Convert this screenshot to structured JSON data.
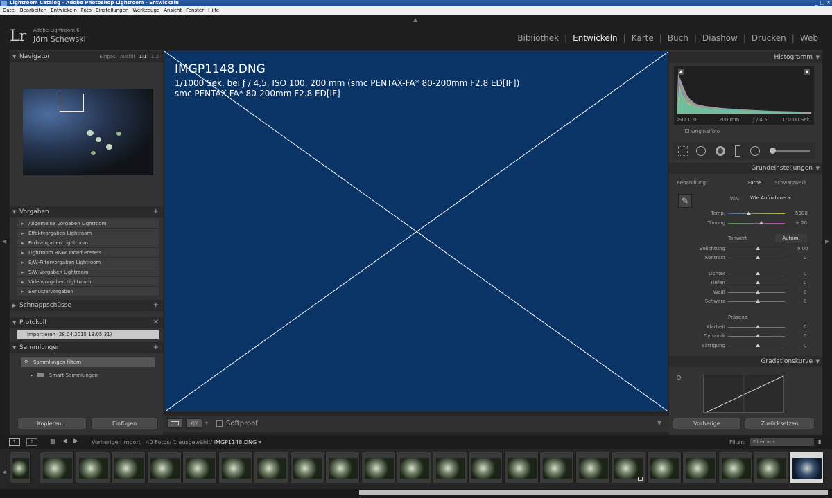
{
  "window": {
    "title": "Lightroom Catalog - Adobe Photoshop Lightroom - Entwickeln"
  },
  "menu": [
    "Datei",
    "Bearbeiten",
    "Entwickeln",
    "Foto",
    "Einstellungen",
    "Werkzeuge",
    "Ansicht",
    "Fenster",
    "Hilfe"
  ],
  "identity": {
    "logo": "Lr",
    "app": "Adobe Lightroom 6",
    "user": "Jörn Schewski"
  },
  "modules": [
    "Bibliothek",
    "Entwickeln",
    "Karte",
    "Buch",
    "Diashow",
    "Drucken",
    "Web"
  ],
  "active_module": "Entwickeln",
  "left": {
    "navigator": {
      "title": "Navigator",
      "options": [
        "Einpas",
        "Ausfül",
        "1:1",
        "1:2"
      ]
    },
    "presets": {
      "title": "Vorgaben",
      "items": [
        "Allgemeine Vorgaben Lightroom",
        "Effektvorgaben Lightroom",
        "Farbvorgaben Lightroom",
        "Lightroom B&W Toned Presets",
        "S/W-Filtervorgaben Lightroom",
        "S/W-Vorgaben Lightroom",
        "Videovorgaben Lightroom",
        "Benutzervorgaben"
      ]
    },
    "snapshots": {
      "title": "Schnappschüsse"
    },
    "history": {
      "title": "Protokoll",
      "item": "Importieren (28.04.2015 13:05:31)"
    },
    "collections": {
      "title": "Sammlungen",
      "filter": "Sammlungen filtern",
      "smart": "Smart-Sammlungen"
    },
    "copy_btn": "Kopieren...",
    "paste_btn": "Einfügen"
  },
  "photo": {
    "filename": "IMGP1148.DNG",
    "line2": "1/1000 Sek. bei ƒ / 4,5, ISO 100, 200 mm (smc PENTAX-FA* 80-200mm F2.8 ED[IF])",
    "line3": "smc PENTAX-FA* 80-200mm F2.8 ED[IF]"
  },
  "toolbar": {
    "softproof": "Softproof",
    "yy": "Y|Y"
  },
  "right": {
    "histogram": {
      "title": "Histogramm",
      "iso": "ISO 100",
      "focal": "200 mm",
      "aperture": "ƒ / 4,5",
      "shutter": "1/1000 Sek.",
      "original": "Originalfoto"
    },
    "basic": {
      "title": "Grundeinstellungen",
      "treatment_label": "Behandlung:",
      "color": "Farbe",
      "bw": "Schwarzweiß",
      "wb_label": "WA:",
      "wb_value": "Wie Aufnahme ÷",
      "tone_label": "Tonwert",
      "auto": "Autom.",
      "presence_label": "Präsenz"
    },
    "sliders": [
      {
        "label": "Temp.",
        "value": "5300"
      },
      {
        "label": "Tönung",
        "value": "+ 20"
      },
      {
        "label": "Belichtung",
        "value": "0,00"
      },
      {
        "label": "Kontrast",
        "value": "0"
      },
      {
        "label": "Lichter",
        "value": "0"
      },
      {
        "label": "Tiefen",
        "value": "0"
      },
      {
        "label": "Weiß",
        "value": "0"
      },
      {
        "label": "Schwarz",
        "value": "0"
      },
      {
        "label": "Klarheit",
        "value": "0"
      },
      {
        "label": "Dynamik",
        "value": "0"
      },
      {
        "label": "Sättigung",
        "value": "0"
      }
    ],
    "curve": {
      "title": "Gradationskurve"
    },
    "prev_btn": "Vorherige",
    "reset_btn": "Zurücksetzen"
  },
  "filmbar": {
    "view1": "1",
    "view2": "2",
    "source": "Vorheriger Import",
    "count": "40 Fotos/ 1 ausgewählt/",
    "current": "IMGP1148.DNG",
    "filter_label": "Filter:",
    "filter_value": "Filter aus"
  }
}
